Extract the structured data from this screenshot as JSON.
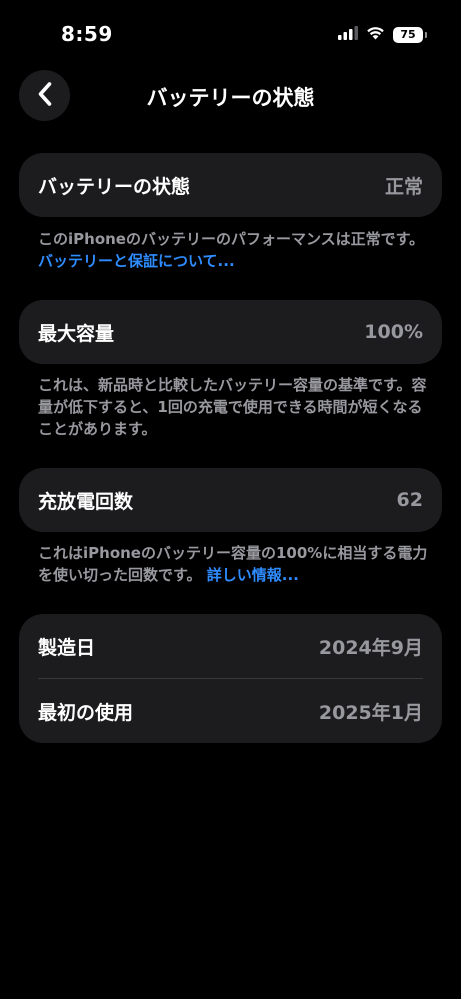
{
  "status_bar": {
    "time": "8:59",
    "battery_level": "75",
    "icons": [
      "cellular-signal-icon",
      "wifi-icon",
      "battery-icon"
    ]
  },
  "nav": {
    "title": "バッテリーの状態",
    "back_icon": "chevron-left-icon"
  },
  "sections": {
    "health": {
      "label": "バッテリーの状態",
      "value": "正常",
      "footnote_text": "このiPhoneのバッテリーのパフォーマンスは正常です。",
      "footnote_link": "バッテリーと保証について..."
    },
    "capacity": {
      "label": "最大容量",
      "value": "100%",
      "footnote_text": "これは、新品時と比較したバッテリー容量の基準です。容量が低下すると、1回の充電で使用できる時間が短くなることがあります。"
    },
    "cycles": {
      "label": "充放電回数",
      "value": "62",
      "footnote_text": "これはiPhoneのバッテリー容量の100%に相当する電力を使い切った回数です。",
      "footnote_link": "詳しい情報..."
    },
    "dates": {
      "manufacture_label": "製造日",
      "manufacture_value": "2024年9月",
      "first_use_label": "最初の使用",
      "first_use_value": "2025年1月"
    }
  },
  "colors": {
    "background": "#000000",
    "card": "#1c1c1e",
    "secondary_text": "#98989f",
    "link": "#2f8cff",
    "divider": "#38383a"
  }
}
